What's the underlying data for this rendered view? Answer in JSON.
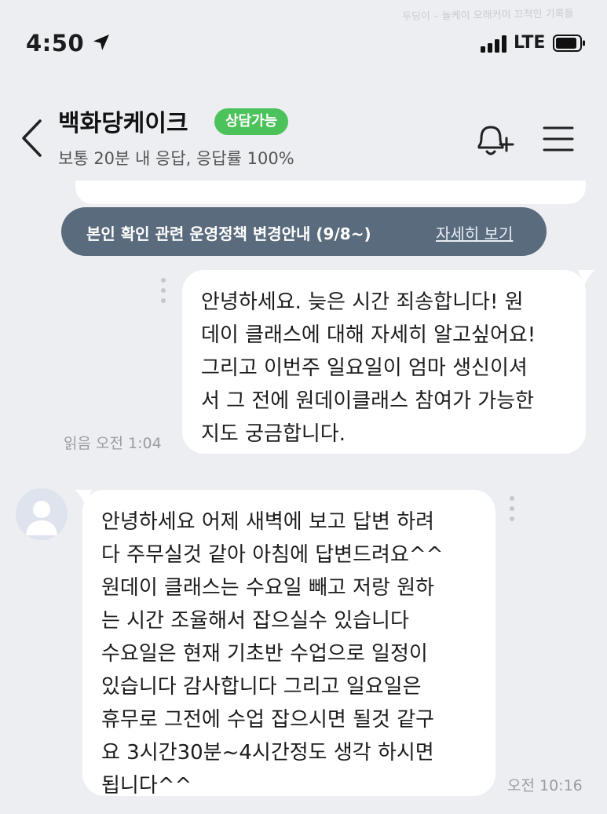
{
  "status_bar": {
    "time": "4:50",
    "network": "LTE",
    "location_icon": "location-arrow-icon",
    "signal_icon": "signal-bars-icon",
    "battery_icon": "battery-icon",
    "watermark": "두딩이 – 놀케이 오래커미 끄적인 기록들"
  },
  "header": {
    "back_icon": "chevron-left-icon",
    "title": "백화당케이크",
    "badge": "상담가능",
    "subtitle": "보통 20분 내 응답, 응답률 100%",
    "bell_icon": "bell-plus-icon",
    "menu_icon": "hamburger-menu-icon"
  },
  "notice": {
    "text": "본인 확인 관련 운영정책 변경안내 (9/8~)",
    "link": "자세히 보기"
  },
  "messages": [
    {
      "direction": "outgoing",
      "text": "안녕하세요. 늦은 시간 죄송합니다! 원\n데이 클래스에 대해 자세히 알고싶어요!\n그리고 이번주 일요일이 엄마 생신이셔\n서 그 전에 원데이클래스 참여가 가능한\n지도 궁금합니다.",
      "meta": "읽음 오전 1:04"
    },
    {
      "direction": "incoming",
      "avatar_icon": "default-avatar-icon",
      "text": "안녕하세요 어제 새벽에 보고 답변 하려\n다 주무실것 같아 아침에 답변드려요^^\n원데이 클래스는 수요일 빼고 저랑 원하\n는 시간 조율해서 잡으실수 있습니다\n수요일은 현재 기초반 수업으로 일정이\n있습니다 감사합니다 그리고 일요일은\n휴무로 그전에 수업 잡으시면 될것 같구\n요 3시간30분~4시간정도 생각 하시면\n됩니다^^",
      "meta": "오전 10:16"
    }
  ],
  "colors": {
    "background": "#eceef1",
    "badge": "#4cc25b",
    "notice": "#5a6b7d",
    "bubble": "#ffffff"
  }
}
